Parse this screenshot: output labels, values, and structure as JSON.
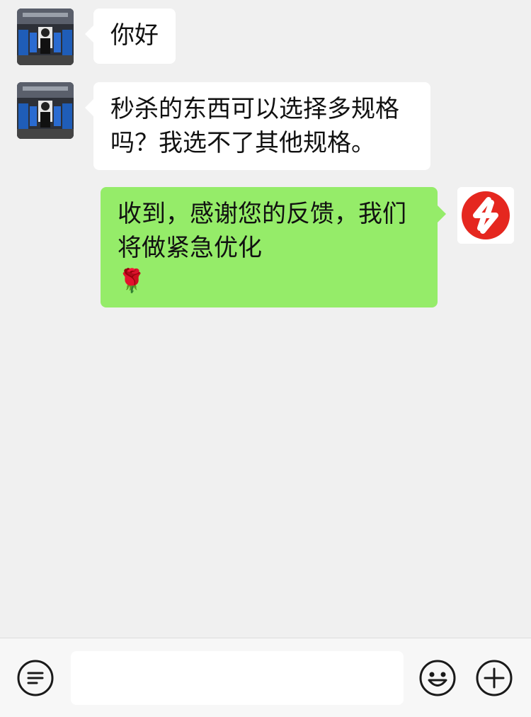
{
  "messages": [
    {
      "side": "left",
      "text": "你好"
    },
    {
      "side": "left",
      "text": "秒杀的东西可以选择多规格\n吗？我选不了其他规格。"
    },
    {
      "side": "right",
      "text": "收到，感谢您的反馈，我们\n将做紧急优化",
      "emoji": "🌹"
    }
  ],
  "input_bar": {
    "voice_icon": "voice-mode-icon",
    "emoji_icon": "emoji-icon",
    "more_icon": "plus-icon",
    "message_field_value": ""
  },
  "colors": {
    "background": "#f0f0f0",
    "incoming_bubble": "#ffffff",
    "outgoing_bubble": "#95ec69",
    "brand_red": "#e5271f"
  }
}
